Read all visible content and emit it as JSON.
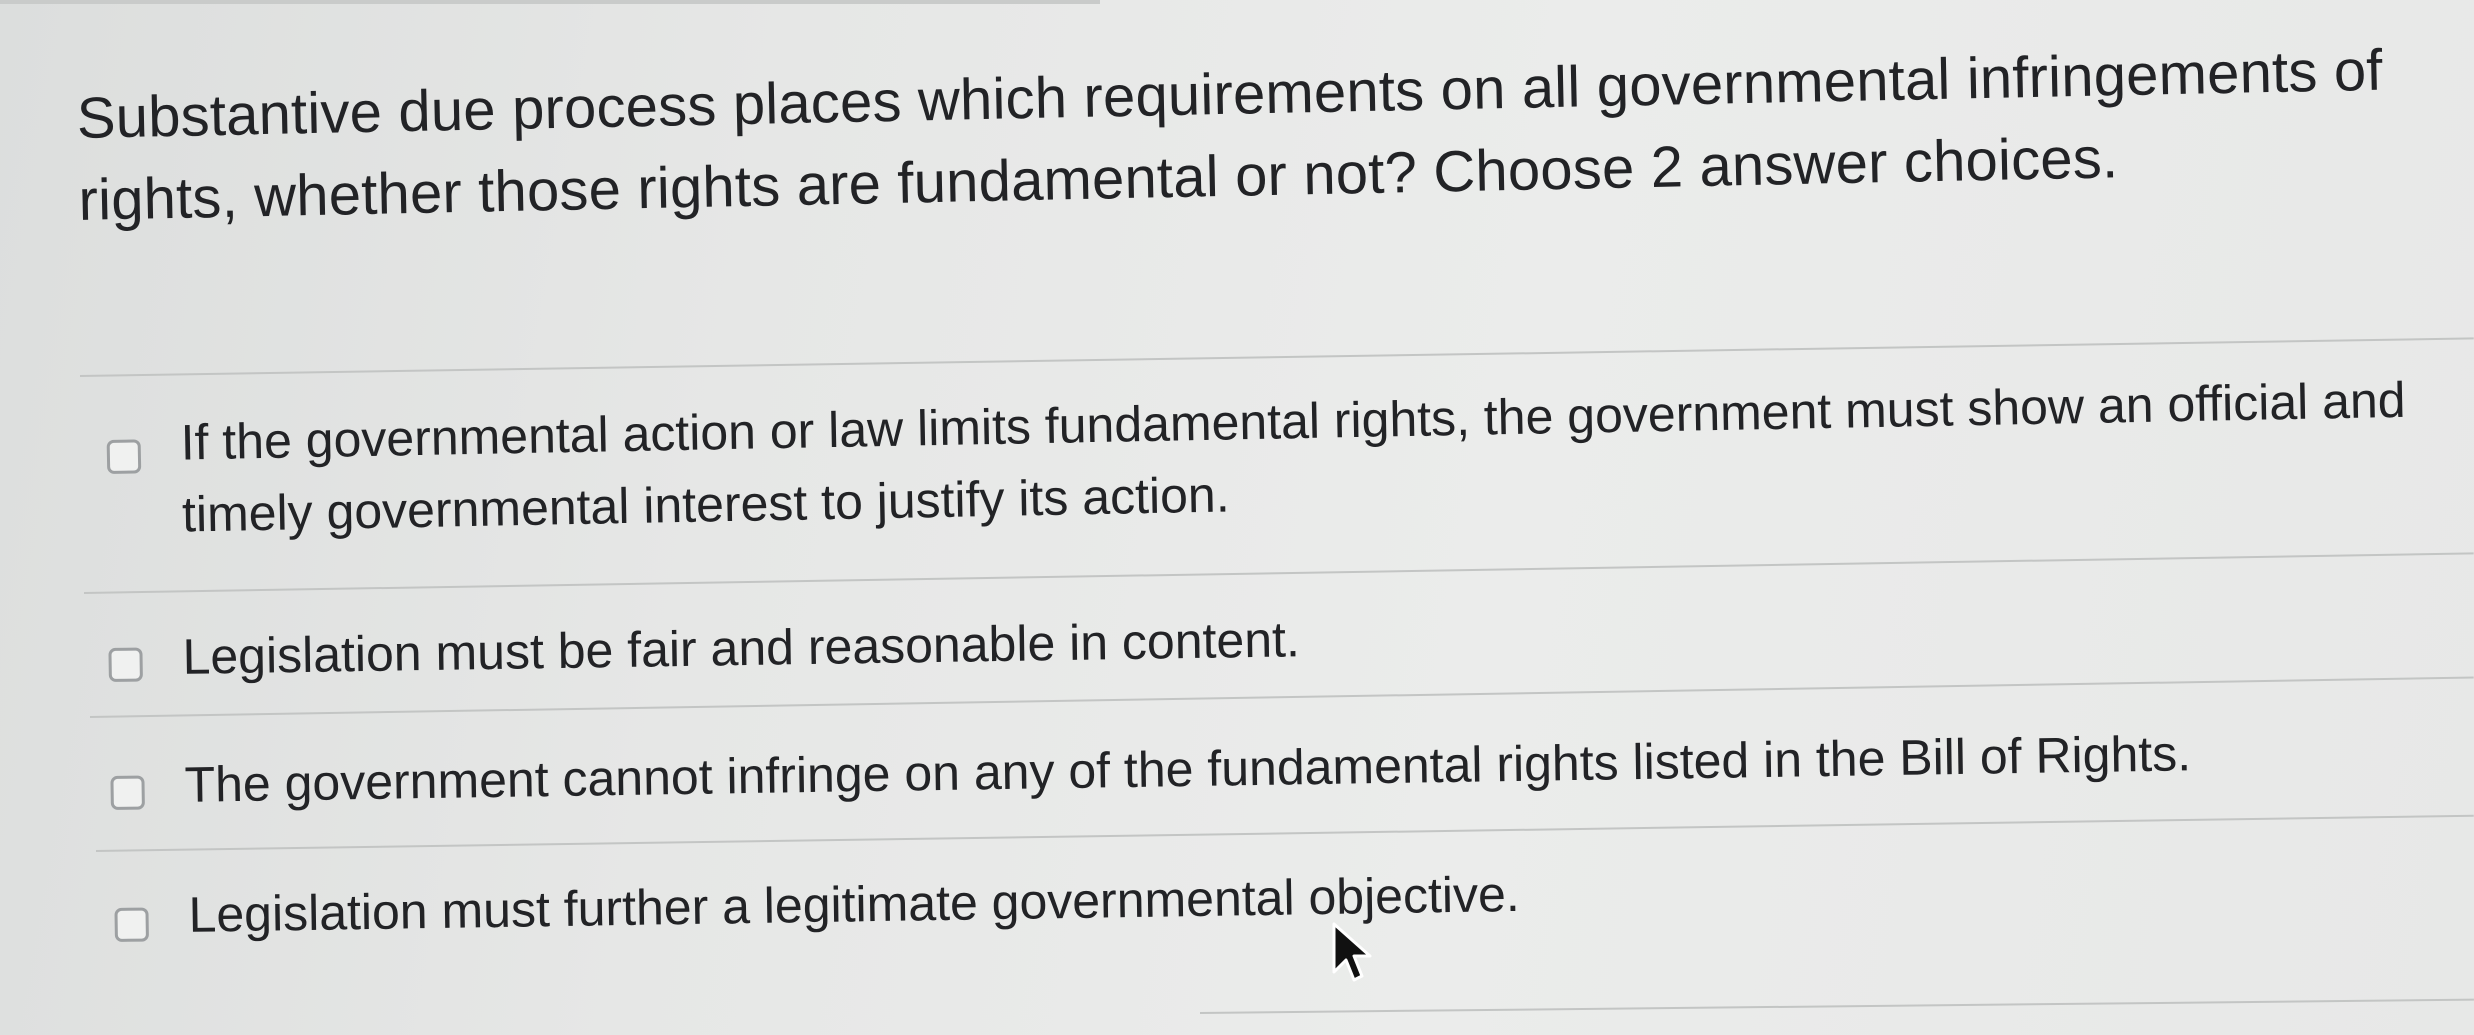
{
  "question": {
    "text": "Substantive due process places which requirements on all governmental infringements of rights, whether those rights are fundamental or not? Choose 2 answer choices."
  },
  "options": [
    {
      "label": "If the governmental action or law limits fundamental rights, the government must show an official and timely governmental interest to justify its action.",
      "checked": false
    },
    {
      "label": "Legislation must be fair and reasonable in content.",
      "checked": false
    },
    {
      "label": "The government cannot infringe on any of the fundamental rights listed in the Bill of Rights.",
      "checked": false
    },
    {
      "label": "Legislation must further a legitimate governmental objective.",
      "checked": false
    }
  ],
  "cursor": {
    "icon": "mouse-pointer-icon"
  }
}
